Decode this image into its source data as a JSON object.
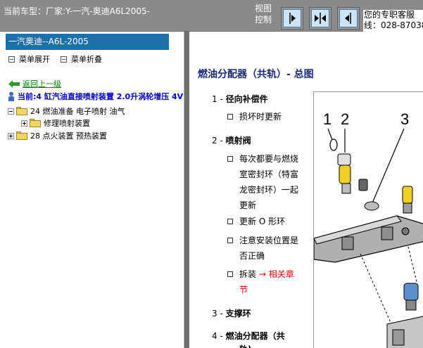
{
  "header": {
    "car_label": "当前车型：厂家:Y-一汽-奥迪A6L2005-",
    "view_control": "视图控制",
    "view_control_tail": "Ⅱ",
    "contact_line1": "您的专职客服",
    "contact_line2": "线：028-87038",
    "buttons": [
      "expand-right",
      "split-view",
      "expand-left"
    ]
  },
  "left_panel": {
    "model_title": "一汽奥迪--A6L-2005",
    "expand_all": "菜单展开",
    "collapse_all": "菜单折叠",
    "back_link": "返回上一级",
    "current": "当前:4 缸汽油直接喷射装置 2.0升涡轮增压 4V",
    "tree": [
      {
        "label": "24 燃油准备 电子喷射 油气",
        "expanded": true,
        "level": 0
      },
      {
        "label": "修理喷射装置",
        "expanded": false,
        "level": 1
      },
      {
        "label": "28 点火装置 预热装置",
        "expanded": false,
        "level": 0
      }
    ]
  },
  "content": {
    "heading": "燃油分配器（共轨）- 总图",
    "items": [
      {
        "num": "1 -",
        "title": "径向补偿件"
      },
      {
        "num": "2 -",
        "title": "喷射阀"
      },
      {
        "num": "3 -",
        "title": "支撑环"
      },
      {
        "num": "4 -",
        "title": "燃油分配器（共"
      }
    ],
    "sub_1": [
      "损坏时更新"
    ],
    "sub_2": [
      [
        "每次都要与燃烧",
        "室密封环（特富",
        "龙密封环）一起",
        "更新"
      ],
      [
        "更新 O 形环"
      ],
      [
        "注意安装位置是",
        "否正确"
      ],
      [
        "拆装",
        "→ 相关章",
        "节"
      ]
    ],
    "item4_cut": "轨)",
    "figure_labels": [
      "1",
      "2",
      "3"
    ]
  }
}
